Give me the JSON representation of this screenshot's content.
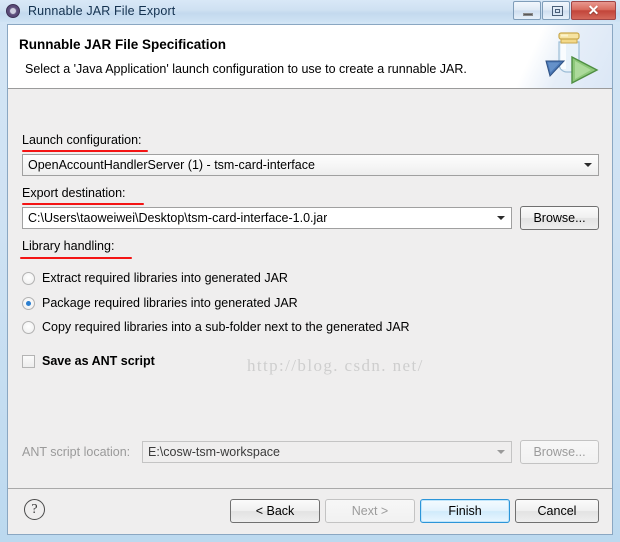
{
  "window": {
    "title": "Runnable JAR File Export",
    "app_icon": "gear-icon",
    "controls": {
      "minimize": "minimize-icon",
      "restore": "restore-icon",
      "close": "✕"
    }
  },
  "header": {
    "title": "Runnable JAR File Specification",
    "description": "Select a 'Java Application' launch configuration to use to create a runnable JAR.",
    "icon": "runnable-jar-icon"
  },
  "form": {
    "launch_configuration": {
      "label": "Launch configuration:",
      "value": "OpenAccountHandlerServer (1) - tsm-card-interface"
    },
    "export_destination": {
      "label": "Export destination:",
      "value": "C:\\Users\\taoweiwei\\Desktop\\tsm-card-interface-1.0.jar",
      "browse_label": "Browse..."
    },
    "library_handling": {
      "label": "Library handling:",
      "options": [
        {
          "label": "Extract required libraries into generated JAR",
          "selected": false
        },
        {
          "label": "Package required libraries into generated JAR",
          "selected": true
        },
        {
          "label": "Copy required libraries into a sub-folder next to the generated JAR",
          "selected": false
        }
      ]
    },
    "save_as_ant": {
      "label": "Save as ANT script",
      "checked": false
    },
    "ant_script_location": {
      "label": "ANT script location:",
      "value": "E:\\cosw-tsm-workspace",
      "browse_label": "Browse...",
      "enabled": false
    }
  },
  "buttons": {
    "help": "?",
    "back": "< Back",
    "next": "Next >",
    "finish": "Finish",
    "cancel": "Cancel"
  },
  "watermark": "http://blog. csdn. net/",
  "colors": {
    "accent": "#2c95d8",
    "annotation": "#f41414",
    "titlebar": "#cfe1f2",
    "dialog_bg": "#efeeee",
    "close_button": "#c2453a"
  }
}
